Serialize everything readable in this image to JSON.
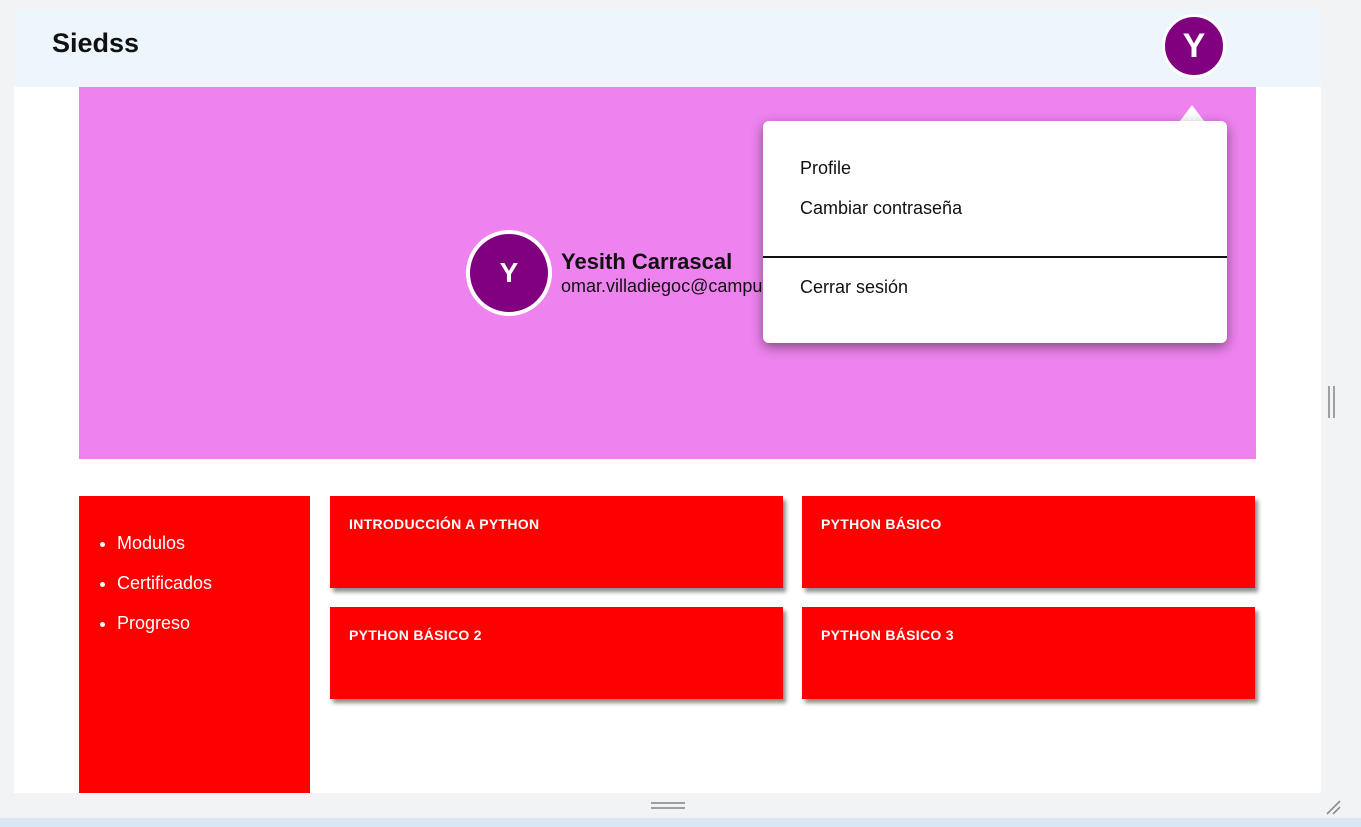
{
  "app": {
    "title": "Siedss",
    "avatar_initial": "Y"
  },
  "profile": {
    "avatar_initial": "Y",
    "name": "Yesith Carrascal",
    "email": "omar.villadiegoc@campu"
  },
  "user_menu": {
    "items": [
      {
        "label": "Profile"
      },
      {
        "label": "Cambiar contraseña"
      }
    ],
    "logout_label": "Cerrar sesión"
  },
  "sidebar": {
    "items": [
      {
        "label": "Modulos"
      },
      {
        "label": "Certificados"
      },
      {
        "label": "Progreso"
      }
    ]
  },
  "courses": [
    {
      "title": "INTRODUCCIÓN A PYTHON"
    },
    {
      "title": "PYTHON BÁSICO"
    },
    {
      "title": "PYTHON BÁSICO 2"
    },
    {
      "title": "PYTHON BÁSICO 3"
    }
  ],
  "colors": {
    "header_bg": "#eef6fd",
    "avatar": "#800080",
    "banner": "#ee82ee",
    "accent_red": "#ff0000"
  },
  "icons": {
    "scroll_grip": "vertical-resize-grip-icon",
    "bottom_grip": "horizontal-resize-grip-icon",
    "corner": "resize-corner-icon"
  }
}
